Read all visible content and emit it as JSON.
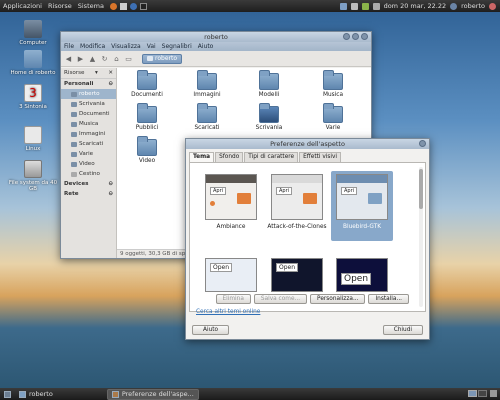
{
  "topbar": {
    "menus": [
      "Applicazioni",
      "Risorse",
      "Sistema"
    ],
    "clock": "dom 20 mar, 22.22",
    "user": "roberto"
  },
  "desktop": {
    "icons": [
      "Computer",
      "Home di roberto",
      "3 Sintonia",
      "Linux",
      "File system da 40 GB"
    ]
  },
  "filemanager": {
    "title": "roberto",
    "menu": [
      "File",
      "Modifica",
      "Visualizza",
      "Vai",
      "Segnalibri",
      "Aiuto"
    ],
    "location_dropdown": "Risorse",
    "breadcrumb": "roberto",
    "sidebar_personal": "Personali",
    "sidebar_items": [
      "roberto",
      "Scrivania",
      "Documenti",
      "Musica",
      "Immagini",
      "Scaricati",
      "Varie",
      "Video",
      "Cestino"
    ],
    "sidebar_devices": "Devices",
    "sidebar_network": "Rete",
    "folders": [
      "Documenti",
      "Immagini",
      "Modelli",
      "Musica",
      "Pubblici",
      "Scaricati",
      "Scrivania",
      "Varie",
      "Video"
    ],
    "status": "9 oggetti, 30,3 GB di spazio libero"
  },
  "dialog": {
    "title": "Preferenze dell'aspetto",
    "tabs": [
      "Tema",
      "Sfondo",
      "Tipi di carattere",
      "Effetti visivi"
    ],
    "themes": [
      "Ambiance",
      "Attack-of-the-Clones",
      "Bluebird-GTK"
    ],
    "preview_labels": {
      "apri": "Apri",
      "open": "Open"
    },
    "buttons": [
      "Elimina",
      "Salva come...",
      "Personalizza...",
      "Installa..."
    ],
    "link": "Cerca altri temi online",
    "help_label": "Aiuto",
    "close_label": "Chiudi"
  },
  "taskbar": {
    "items": [
      "roberto",
      "Preferenze dell'aspe..."
    ]
  }
}
